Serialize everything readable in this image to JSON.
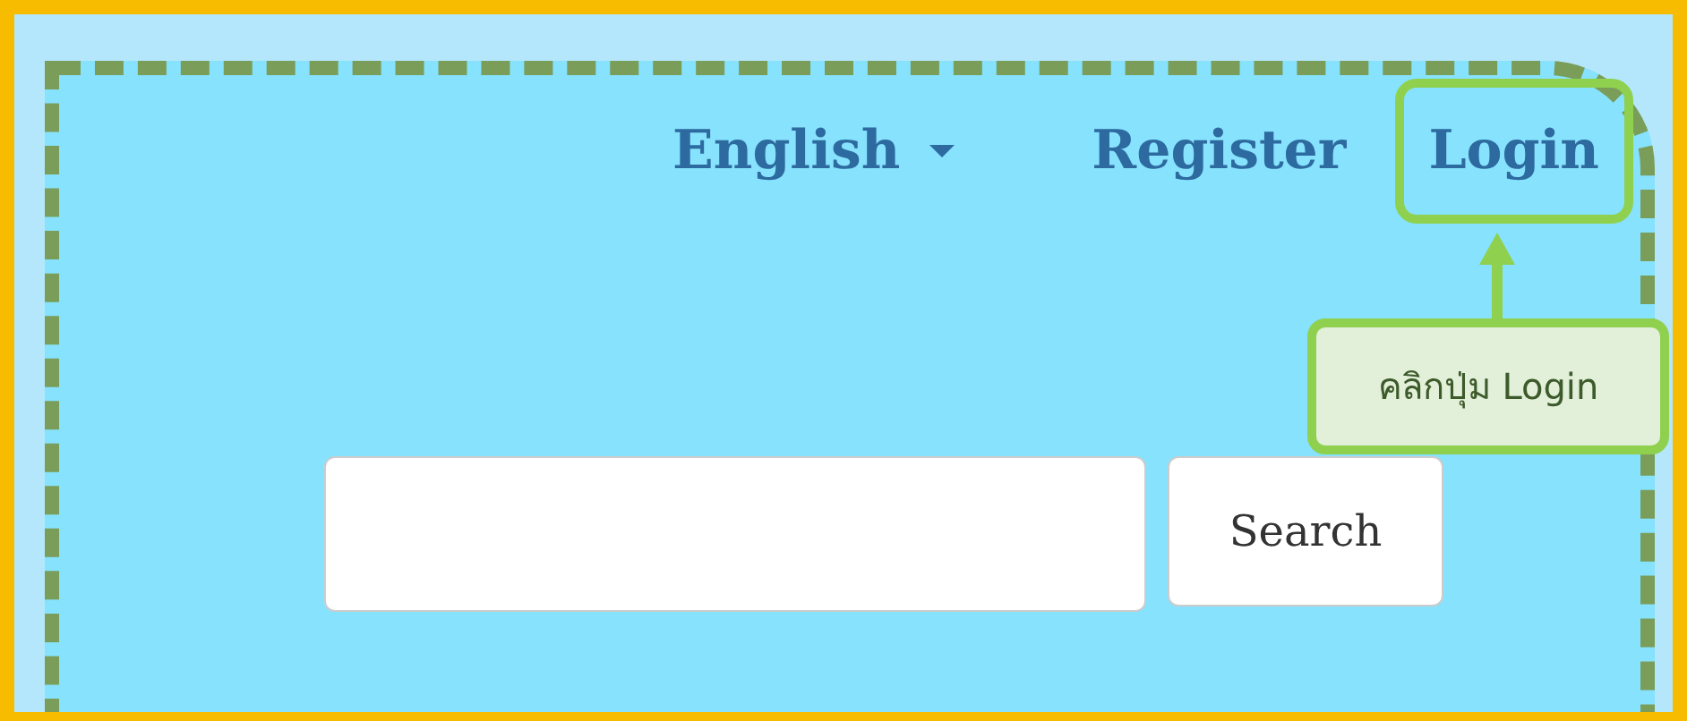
{
  "nav": {
    "language": "English",
    "links": [
      {
        "label": "Register",
        "highlighted": false
      },
      {
        "label": "Login",
        "highlighted": true
      }
    ]
  },
  "search": {
    "button": "Search"
  },
  "callout": {
    "text": "คลิกปุ่ม Login"
  }
}
